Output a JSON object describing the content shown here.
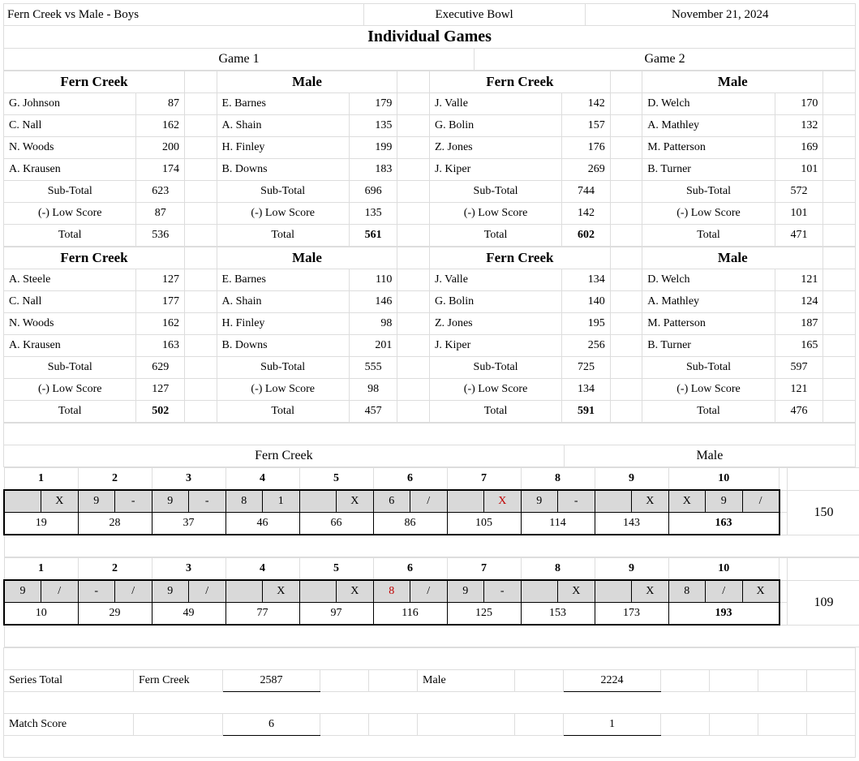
{
  "header": {
    "match": "Fern Creek vs Male - Boys",
    "venue": "Executive Bowl",
    "date": "November 21, 2024"
  },
  "section_title": "Individual Games",
  "games": [
    "Game 1",
    "Game 2"
  ],
  "teams": [
    "Fern Creek",
    "Male"
  ],
  "labels": {
    "subtotal": "Sub-Total",
    "lowscore": "(-) Low Score",
    "total": "Total",
    "series_total": "Series Total",
    "match_score": "Match Score"
  },
  "blocks": [
    {
      "g1_fc": {
        "players": [
          [
            "G. Johnson",
            "87"
          ],
          [
            "C. Nall",
            "162"
          ],
          [
            "N. Woods",
            "200"
          ],
          [
            "A. Krausen",
            "174"
          ]
        ],
        "sub": "623",
        "low": "87",
        "total": "536",
        "bold": false
      },
      "g1_m": {
        "players": [
          [
            "E. Barnes",
            "179"
          ],
          [
            "A. Shain",
            "135"
          ],
          [
            "H. Finley",
            "199"
          ],
          [
            "B. Downs",
            "183"
          ]
        ],
        "sub": "696",
        "low": "135",
        "total": "561",
        "bold": true
      },
      "g2_fc": {
        "players": [
          [
            "J. Valle",
            "142"
          ],
          [
            "G. Bolin",
            "157"
          ],
          [
            "Z. Jones",
            "176"
          ],
          [
            "J. Kiper",
            "269"
          ]
        ],
        "sub": "744",
        "low": "142",
        "total": "602",
        "bold": true
      },
      "g2_m": {
        "players": [
          [
            "D. Welch",
            "170"
          ],
          [
            "A. Mathley",
            "132"
          ],
          [
            "M. Patterson",
            "169"
          ],
          [
            "B. Turner",
            "101"
          ]
        ],
        "sub": "572",
        "low": "101",
        "total": "471",
        "bold": false
      }
    },
    {
      "g1_fc": {
        "players": [
          [
            "A. Steele",
            "127"
          ],
          [
            "C. Nall",
            "177"
          ],
          [
            "N. Woods",
            "162"
          ],
          [
            "A. Krausen",
            "163"
          ]
        ],
        "sub": "629",
        "low": "127",
        "total": "502",
        "bold": true
      },
      "g1_m": {
        "players": [
          [
            "E. Barnes",
            "110"
          ],
          [
            "A. Shain",
            "146"
          ],
          [
            "H. Finley",
            "98"
          ],
          [
            "B. Downs",
            "201"
          ]
        ],
        "sub": "555",
        "low": "98",
        "total": "457",
        "bold": false
      },
      "g2_fc": {
        "players": [
          [
            "J. Valle",
            "134"
          ],
          [
            "G. Bolin",
            "140"
          ],
          [
            "Z. Jones",
            "195"
          ],
          [
            "J. Kiper",
            "256"
          ]
        ],
        "sub": "725",
        "low": "134",
        "total": "591",
        "bold": true
      },
      "g2_m": {
        "players": [
          [
            "D. Welch",
            "121"
          ],
          [
            "A. Mathley",
            "124"
          ],
          [
            "M. Patterson",
            "187"
          ],
          [
            "B. Turner",
            "165"
          ]
        ],
        "sub": "597",
        "low": "121",
        "total": "476",
        "bold": false
      }
    }
  ],
  "baker": {
    "fc_team": "Fern Creek",
    "m_team": "Male",
    "frame_nums": [
      "1",
      "2",
      "3",
      "4",
      "5",
      "6",
      "7",
      "8",
      "9",
      "10"
    ],
    "lines": [
      {
        "balls": [
          "",
          "X",
          "9",
          "-",
          "9",
          "-",
          "8",
          "1",
          "",
          "X",
          "6",
          "/",
          "",
          "X",
          "9",
          "-",
          "",
          "X",
          "X",
          "9",
          "/"
        ],
        "red_idx": [
          13
        ],
        "cum": [
          "19",
          "28",
          "37",
          "46",
          "66",
          "86",
          "105",
          "114",
          "143",
          "163"
        ],
        "opp": "150"
      },
      {
        "balls": [
          "9",
          "/",
          "-",
          "/",
          "9",
          "/",
          "",
          "X",
          "",
          "X",
          "8",
          "/",
          "9",
          "-",
          "",
          "X",
          "",
          "X",
          "8",
          "/",
          "X"
        ],
        "red_idx": [
          10
        ],
        "cum": [
          "10",
          "29",
          "49",
          "77",
          "97",
          "116",
          "125",
          "153",
          "173",
          "193"
        ],
        "opp": "109"
      }
    ]
  },
  "summary": {
    "fc_series": "2587",
    "m_series": "2224",
    "fc_match": "6",
    "m_match": "1"
  }
}
